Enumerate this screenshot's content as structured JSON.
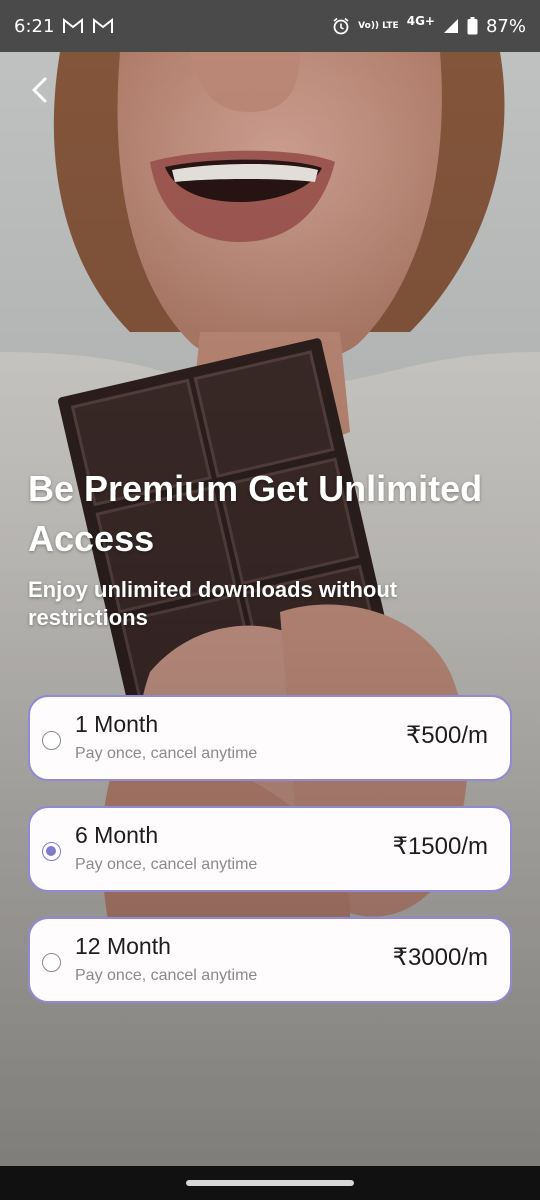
{
  "status_bar": {
    "time": "6:21",
    "left_icons": [
      "gmail-icon",
      "gmail-icon"
    ],
    "right_icons": [
      "alarm-icon",
      "volte-icon",
      "signal-icon",
      "battery-icon"
    ],
    "volte_label": "Vo)) LTE",
    "network_label": "4G+",
    "battery_percent": "87%"
  },
  "header": {
    "back_icon": "chevron-left-icon"
  },
  "hero": {
    "title": "Be Premium Get Unlimited Access",
    "subtitle": "Enjoy unlimited downloads without restrictions"
  },
  "plans": [
    {
      "title": "1 Month",
      "note": "Pay once, cancel anytime",
      "price": "₹500/m",
      "selected": false
    },
    {
      "title": "6 Month",
      "note": "Pay once, cancel anytime",
      "price": "₹1500/m",
      "selected": true
    },
    {
      "title": "12 Month",
      "note": "Pay once, cancel anytime",
      "price": "₹3000/m",
      "selected": false
    }
  ],
  "colors": {
    "accent": "#7f79cf",
    "card_bg": "#fefcfd",
    "text_dark": "#1d1d1d",
    "text_muted": "#8a8a8a"
  }
}
